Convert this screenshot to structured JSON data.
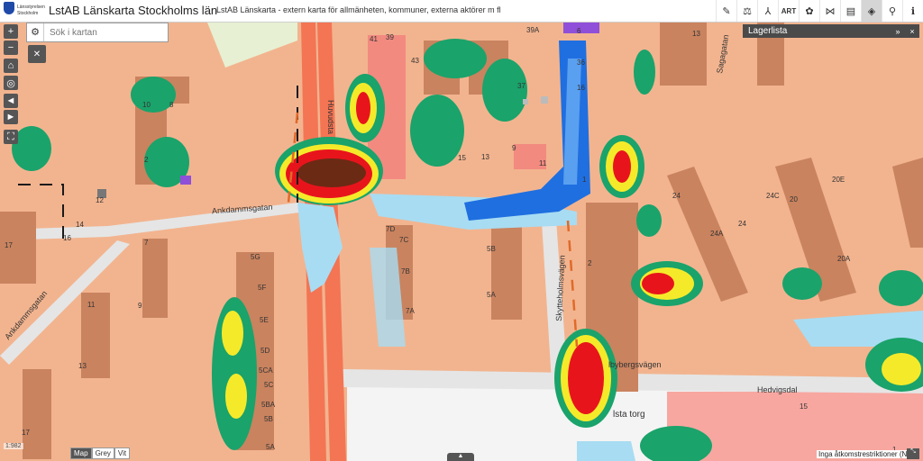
{
  "header": {
    "logo_line1": "Länsstyrelsen",
    "logo_line2": "Stockholm",
    "title": "LstAB Länskarta Stockholms län",
    "subtitle": "LstAB Länskarta - extern karta för allmänheten, kommuner, externa aktörer m fl",
    "tools": [
      {
        "name": "draw-icon",
        "glyph": "✎"
      },
      {
        "name": "measure-icon",
        "glyph": "⚖"
      },
      {
        "name": "coordinates-icon",
        "glyph": "⅄"
      },
      {
        "name": "art-button",
        "glyph": "ART"
      },
      {
        "name": "palette-icon",
        "glyph": "✿"
      },
      {
        "name": "share-icon",
        "glyph": "⋈"
      },
      {
        "name": "print-icon",
        "glyph": "▤"
      },
      {
        "name": "layers-icon",
        "glyph": "◈"
      },
      {
        "name": "search-icon",
        "glyph": "⚲"
      },
      {
        "name": "info-icon",
        "glyph": "ℹ"
      }
    ]
  },
  "search": {
    "placeholder": "Sök i kartan"
  },
  "layer_panel": {
    "title": "Lagerlista",
    "collapse": "»",
    "close": "×"
  },
  "map": {
    "streets": [
      "Ankdammsgatan",
      "Ankdammsgatan",
      "Huvudsta",
      "Skytteholmsvägen",
      "lbybergsvägen",
      "Hedvigsdal",
      "Sagagatan",
      "lsta torg"
    ],
    "labels": [
      "39",
      "41",
      "43",
      "39A",
      "36",
      "37",
      "13",
      "16",
      "10",
      "8",
      "2",
      "12",
      "14",
      "16",
      "17",
      "7",
      "9",
      "11",
      "13",
      "17",
      "6",
      "5G",
      "5F",
      "5E",
      "5D",
      "5CA",
      "5C",
      "5BA",
      "5B",
      "5A",
      "7D",
      "7C",
      "7B",
      "7A",
      "5B",
      "5A",
      "15",
      "13",
      "9",
      "11",
      "2",
      "1",
      "24",
      "24A",
      "24",
      "20A",
      "20",
      "24C",
      "20E",
      "15",
      "1"
    ]
  },
  "controls": {
    "zoom_in": "+",
    "zoom_out": "−",
    "home": "⌂",
    "locate": "◎",
    "back": "◄",
    "forward": "►",
    "fullscreen": "⛶"
  },
  "bottom": {
    "scale": "1:982",
    "basemaps": [
      "Map",
      "Grey",
      "Vit"
    ],
    "active_basemap": "Map",
    "footnote": "Inga åtkomstrestriktioner (NO)",
    "handle": "▲"
  },
  "colors": {
    "building": "#c9835f",
    "ground": "#f2b48f",
    "road_main": "#e8573a",
    "flood_dark": "#6b2a14",
    "flood_red": "#e8141c",
    "flood_yellow": "#f5ea2a",
    "flood_green": "#1aa36b",
    "flood_lightblue": "#a8dcf2",
    "flood_blue": "#1f6fe0"
  }
}
